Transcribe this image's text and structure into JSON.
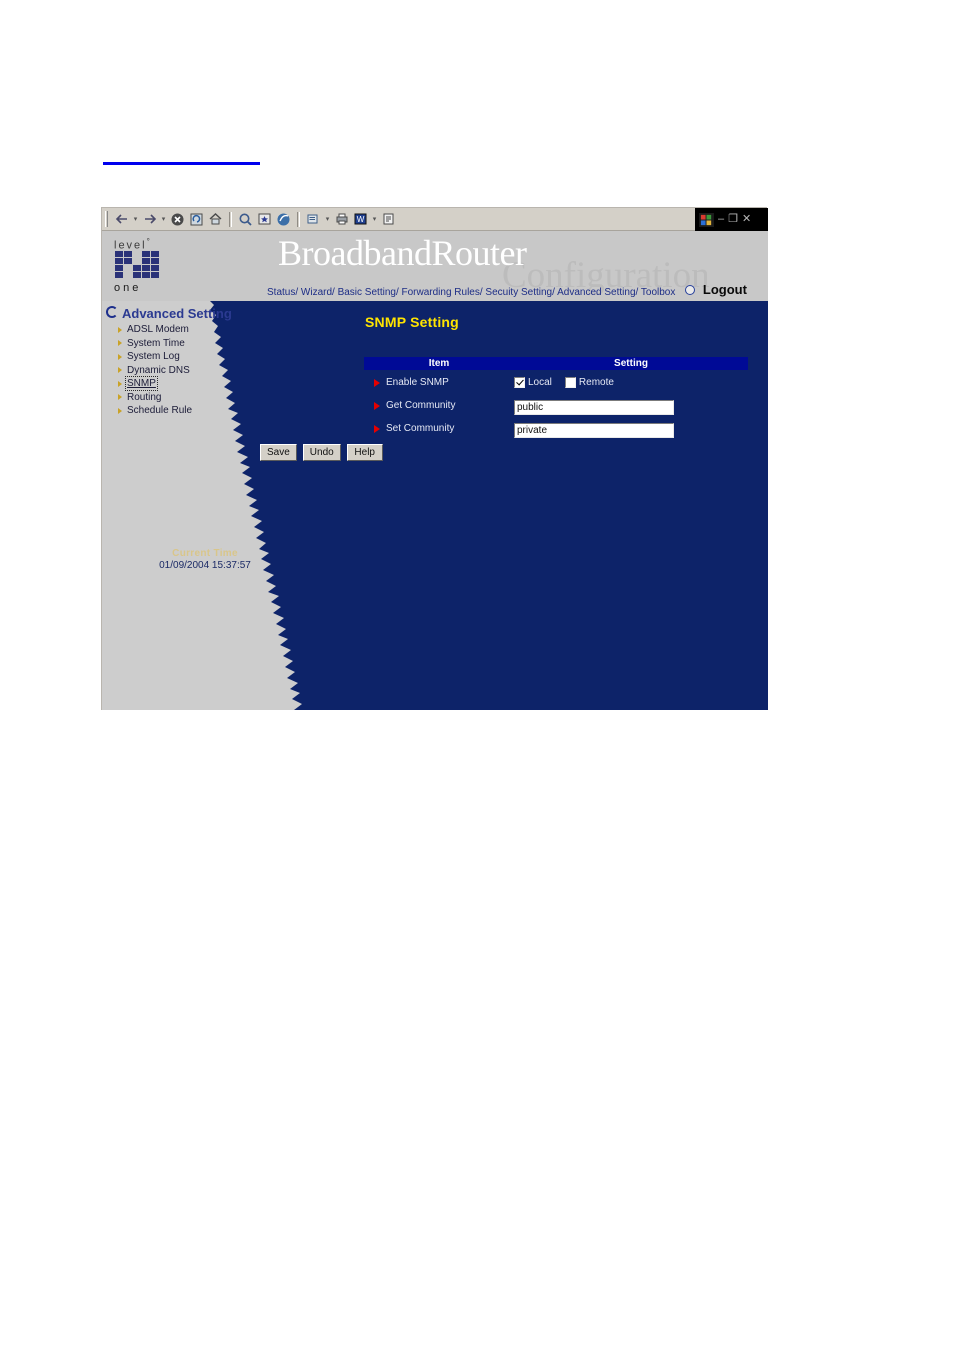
{
  "browser": {
    "toolbar_buttons": [
      {
        "name": "back-button",
        "glyph": "←"
      },
      {
        "name": "back-dropdown",
        "glyph": "▾"
      },
      {
        "name": "forward-button",
        "glyph": "→"
      },
      {
        "name": "forward-dropdown",
        "glyph": "▾"
      },
      {
        "name": "stop-button",
        "glyph": "✖"
      },
      {
        "name": "refresh-button",
        "glyph": "↻"
      },
      {
        "name": "home-button",
        "glyph": "⌂"
      },
      {
        "name": "search-button",
        "glyph": "⌕"
      },
      {
        "name": "favorites-button",
        "glyph": "★"
      },
      {
        "name": "media-button",
        "glyph": "◔"
      },
      {
        "name": "history-button",
        "glyph": "☷"
      },
      {
        "name": "history-dropdown",
        "glyph": "▾"
      },
      {
        "name": "mail-button",
        "glyph": "✉"
      },
      {
        "name": "print-button",
        "glyph": "⎙"
      },
      {
        "name": "edit-button",
        "glyph": "W"
      },
      {
        "name": "edit-dropdown",
        "glyph": "▾"
      },
      {
        "name": "discuss-button",
        "glyph": "≡"
      }
    ],
    "window_controls": {
      "minimize": "–",
      "restore": "❐",
      "close": "✕"
    }
  },
  "header": {
    "brand_top": "level",
    "brand_top_sup": "°",
    "brand_bottom": "one",
    "title": "BroadbandRouter",
    "watermark": "Configuration",
    "nav": "Status/ Wizard/ Basic Setting/ Forwarding Rules/ Secuity Setting/ Advanced Setting/ Toolbox",
    "logout_label": "Logout"
  },
  "sidebar": {
    "heading": "Advanced Setting",
    "items": [
      {
        "label": "ADSL Modem",
        "selected": false
      },
      {
        "label": "System Time",
        "selected": false
      },
      {
        "label": "System Log",
        "selected": false
      },
      {
        "label": "Dynamic DNS",
        "selected": false
      },
      {
        "label": "SNMP",
        "selected": true
      },
      {
        "label": "Routing",
        "selected": false
      },
      {
        "label": "Schedule Rule",
        "selected": false
      }
    ],
    "current_time_label": "Current Time",
    "current_time_value": "01/09/2004 15:37:57"
  },
  "main": {
    "page_title": "SNMP Setting",
    "columns": [
      "Item",
      "Setting"
    ],
    "rows": [
      {
        "item": "Enable SNMP",
        "type": "checkboxes",
        "checkboxes": [
          {
            "label": "Local",
            "checked": true
          },
          {
            "label": "Remote",
            "checked": false
          }
        ]
      },
      {
        "item": "Get Community",
        "type": "text",
        "value": "public"
      },
      {
        "item": "Set Community",
        "type": "text",
        "value": "private"
      }
    ],
    "buttons": [
      {
        "name": "save-button",
        "label": "Save"
      },
      {
        "name": "undo-button",
        "label": "Undo"
      },
      {
        "name": "help-button",
        "label": "Help"
      }
    ]
  },
  "colors": {
    "navy": "#0d2369",
    "table_header_blue": "#000a96",
    "title_yellow": "#ffe400",
    "sidebar_gray": "#cdcdcd",
    "accent_red": "#e50000",
    "link_blue": "#0000ee"
  }
}
